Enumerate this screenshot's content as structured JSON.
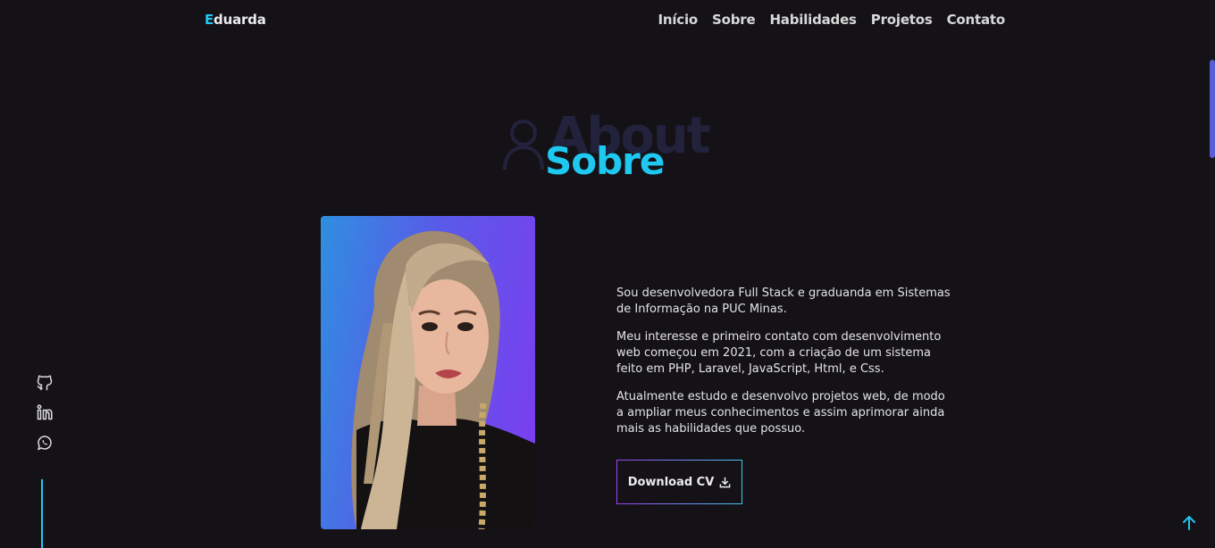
{
  "nav": {
    "logo_initial": "E",
    "logo_rest": "duarda",
    "items": [
      "Início",
      "Sobre",
      "Habilidades",
      "Projetos",
      "Contato"
    ]
  },
  "section": {
    "bg_title": "About",
    "title": "Sobre"
  },
  "about": {
    "paragraphs": [
      "Sou desenvolvedora Full Stack e graduanda em Sistemas de Informação na PUC Minas.",
      "Meu interesse e primeiro contato com desenvolvimento web começou em 2021, com a criação de um sistema feito em PHP, Laravel, JavaScript, Html, e Css.",
      "Atualmente estudo e desenvolvo projetos web, de modo a ampliar meus conhecimentos e assim aprimorar ainda mais as habilidades que possuo."
    ],
    "cv_label": "Download CV"
  },
  "social": {
    "icons": [
      "github-icon",
      "linkedin-icon",
      "whatsapp-icon"
    ]
  },
  "colors": {
    "accent": "#1ec8f0",
    "background": "#141217",
    "bg_title": "#23223c"
  }
}
